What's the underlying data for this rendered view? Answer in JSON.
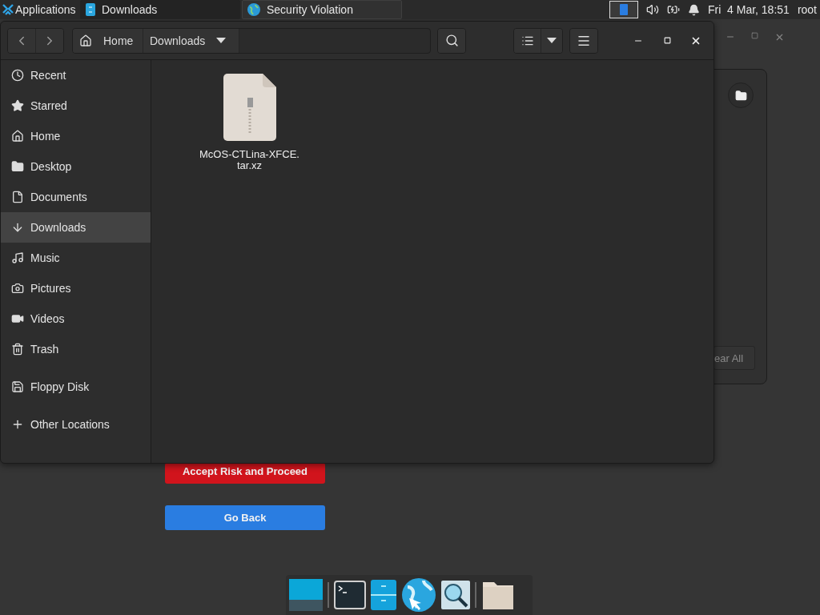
{
  "top_panel": {
    "applications_menu": "Applications",
    "tasks": [
      {
        "label": "Downloads",
        "selected": true
      },
      {
        "label": "Security Violation",
        "selected": false
      }
    ],
    "clock": "Fri  4 Mar, 18:51",
    "user": "root"
  },
  "browser_window": {
    "notification_panel": {
      "clear_button": "ear All"
    },
    "buttons": [
      {
        "label": "Accept Risk and Proceed",
        "kind": "danger"
      },
      {
        "label": "Go Back",
        "kind": "primary"
      }
    ]
  },
  "file_manager": {
    "path": [
      {
        "label": "Home",
        "kind": "home"
      },
      {
        "label": "Downloads",
        "kind": "current"
      }
    ],
    "sidebar": [
      {
        "items": [
          {
            "label": "Recent",
            "kind": "recent",
            "selected": false
          },
          {
            "label": "Starred",
            "kind": "starred",
            "selected": false
          },
          {
            "label": "Home",
            "kind": "home",
            "selected": false
          },
          {
            "label": "Desktop",
            "kind": "desktop",
            "selected": false
          },
          {
            "label": "Documents",
            "kind": "documents",
            "selected": false
          },
          {
            "label": "Downloads",
            "kind": "downloads",
            "selected": true
          },
          {
            "label": "Music",
            "kind": "music",
            "selected": false
          },
          {
            "label": "Pictures",
            "kind": "pictures",
            "selected": false
          },
          {
            "label": "Videos",
            "kind": "videos",
            "selected": false
          },
          {
            "label": "Trash",
            "kind": "trash",
            "selected": false
          }
        ]
      },
      {
        "items": [
          {
            "label": "Floppy Disk",
            "kind": "floppy",
            "selected": false
          }
        ]
      },
      {
        "items": [
          {
            "label": "Other Locations",
            "kind": "other",
            "selected": false
          }
        ]
      }
    ],
    "files": [
      {
        "name_lines": [
          "McOS-CTLina-XFCE.",
          "tar.xz"
        ]
      }
    ]
  }
}
